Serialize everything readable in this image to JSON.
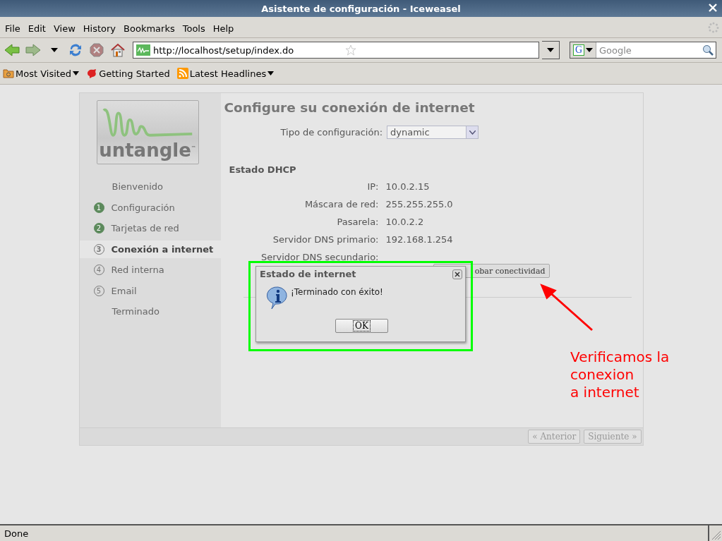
{
  "window": {
    "title": "Asistente de configuración - Iceweasel"
  },
  "menu": [
    {
      "label": "File"
    },
    {
      "label": "Edit"
    },
    {
      "label": "View"
    },
    {
      "label": "History"
    },
    {
      "label": "Bookmarks"
    },
    {
      "label": "Tools"
    },
    {
      "label": "Help"
    }
  ],
  "address": {
    "url": "http://localhost/setup/index.do"
  },
  "search": {
    "engine": "G",
    "placeholder": "Google"
  },
  "bookmarks": [
    {
      "label": "Most Visited",
      "kind": "folder"
    },
    {
      "label": "Getting Started",
      "kind": "link"
    },
    {
      "label": "Latest Headlines",
      "kind": "feed"
    }
  ],
  "wizard": {
    "logo": "untangle$^{™}$",
    "steps": [
      {
        "label": "Bienvenido",
        "selected": false
      },
      {
        "number": "1",
        "label": "Configuración",
        "done": true,
        "selected": false
      },
      {
        "number": "2",
        "label": "Tarjetas de red",
        "done": true,
        "selected": false
      },
      {
        "number": "3",
        "label": "Conexión a internet",
        "done": false,
        "selected": true
      },
      {
        "number": "4",
        "label": "Red interna",
        "done": false,
        "selected": false
      },
      {
        "number": "5",
        "label": "Email",
        "done": false,
        "selected": false
      },
      {
        "label": "Terminado",
        "selected": false
      }
    ],
    "heading": "Configure su conexión de internet",
    "config_type": {
      "label": "Tipo de configuración:",
      "value": "dynamic"
    },
    "section_title": "Estado DHCP",
    "fields": [
      {
        "label": "IP:",
        "value": "10.0.2.15"
      },
      {
        "label": "Máscara de red:",
        "value": "255.255.255.0"
      },
      {
        "label": "Pasarela:",
        "value": "10.0.2.2"
      },
      {
        "label": "Servidor DNS primario:",
        "value": "192.168.1.254"
      },
      {
        "label": "Servidor DNS secundario:"
      }
    ],
    "test_button": "obar conectividad",
    "nav_buttons": [
      {
        "label": "« Anterior",
        "disabled": true
      },
      {
        "label": "Siguiente »",
        "disabled": true
      }
    ]
  },
  "dialog": {
    "title": "Estado de internet",
    "message": "¡Terminado con éxito!",
    "button": "OK"
  },
  "annotation": {
    "lines": [
      "Verificamos la",
      "conexion",
      "a internet"
    ]
  },
  "status_bar": {
    "text": "Done"
  }
}
